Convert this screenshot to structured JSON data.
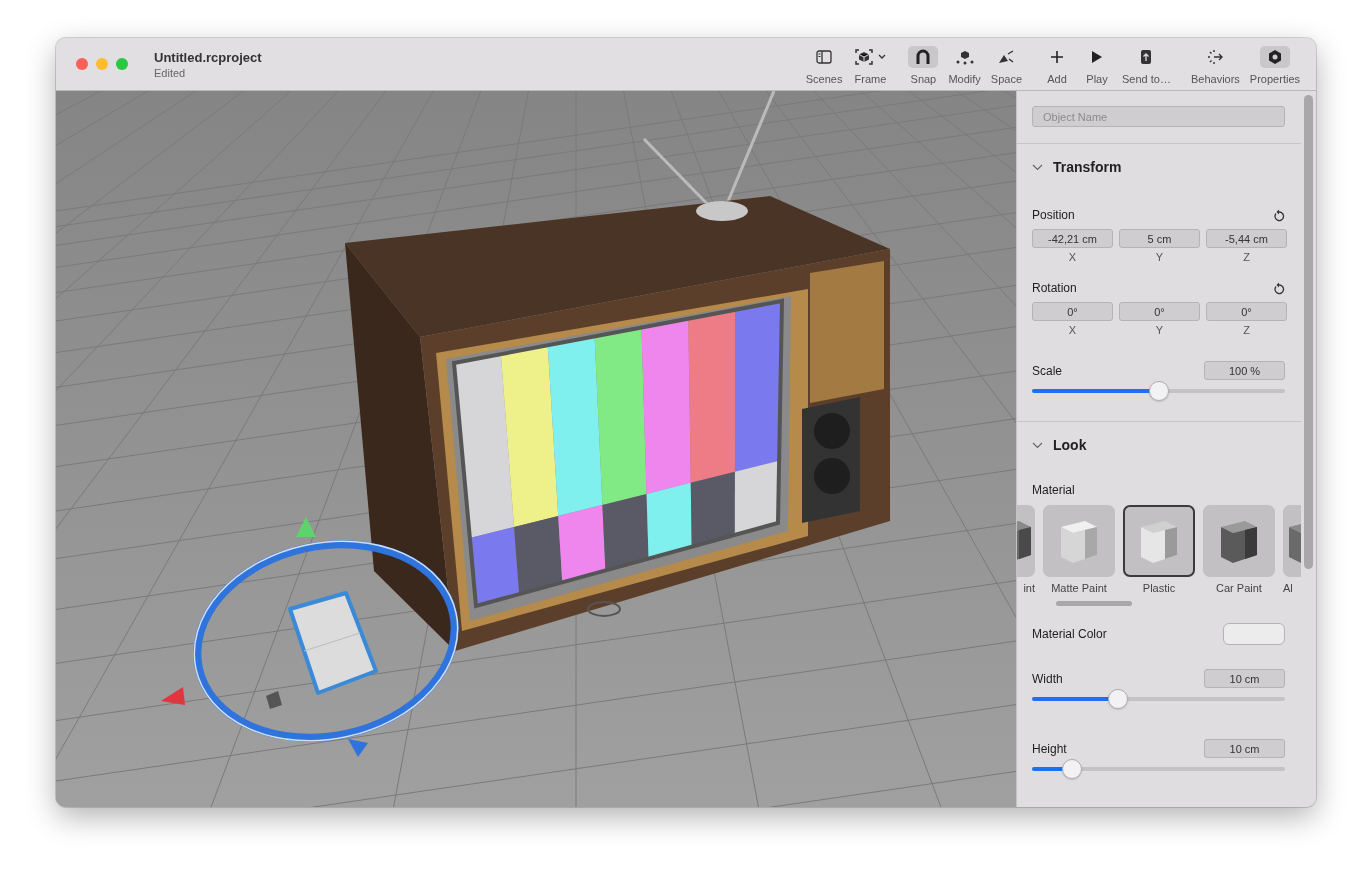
{
  "window": {
    "title": "Untitled.rcproject",
    "subtitle": "Edited"
  },
  "toolbar": [
    {
      "label": "Scenes",
      "selected": false,
      "dropdown": false
    },
    {
      "label": "Frame",
      "selected": false,
      "dropdown": true
    },
    {
      "label": "Snap",
      "selected": true,
      "dropdown": false
    },
    {
      "label": "Modify",
      "selected": false,
      "dropdown": false
    },
    {
      "label": "Space",
      "selected": false,
      "dropdown": false
    },
    {
      "label": "Add",
      "selected": false,
      "dropdown": false
    },
    {
      "label": "Play",
      "selected": false,
      "dropdown": false
    },
    {
      "label": "Send to…",
      "selected": false,
      "dropdown": false
    },
    {
      "label": "Behaviors",
      "selected": false,
      "dropdown": false
    },
    {
      "label": "Properties",
      "selected": true,
      "dropdown": false
    }
  ],
  "inspector": {
    "object_name": {
      "placeholder": "Object Name"
    },
    "transform": {
      "title": "Transform",
      "expanded": true,
      "position": {
        "label": "Position",
        "fields": [
          {
            "value": "-42,21 cm",
            "axis": "X"
          },
          {
            "value": "5 cm",
            "axis": "Y"
          },
          {
            "value": "-5,44 cm",
            "axis": "Z"
          }
        ]
      },
      "rotation": {
        "label": "Rotation",
        "fields": [
          {
            "value": "0°",
            "axis": "X"
          },
          {
            "value": "0°",
            "axis": "Y"
          },
          {
            "value": "0°",
            "axis": "Z"
          }
        ]
      },
      "scale": {
        "label": "Scale",
        "value": "100 %",
        "level": 0.5
      }
    },
    "look": {
      "title": "Look",
      "expanded": true,
      "material": {
        "label": "Material",
        "options": [
          {
            "label": "int",
            "kind": "metal",
            "selected": false
          },
          {
            "label": "Matte Paint",
            "kind": "matte",
            "selected": false
          },
          {
            "label": "Plastic",
            "kind": "plastic",
            "selected": true
          },
          {
            "label": "Car Paint",
            "kind": "car-paint",
            "selected": false
          },
          {
            "label": "Al",
            "kind": "metal",
            "selected": false
          }
        ]
      },
      "material_color": {
        "label": "Material Color"
      },
      "width": {
        "label": "Width",
        "value": "10 cm",
        "level": 0.34
      },
      "height": {
        "label": "Height",
        "value": "10 cm",
        "level": 0.16
      }
    }
  }
}
